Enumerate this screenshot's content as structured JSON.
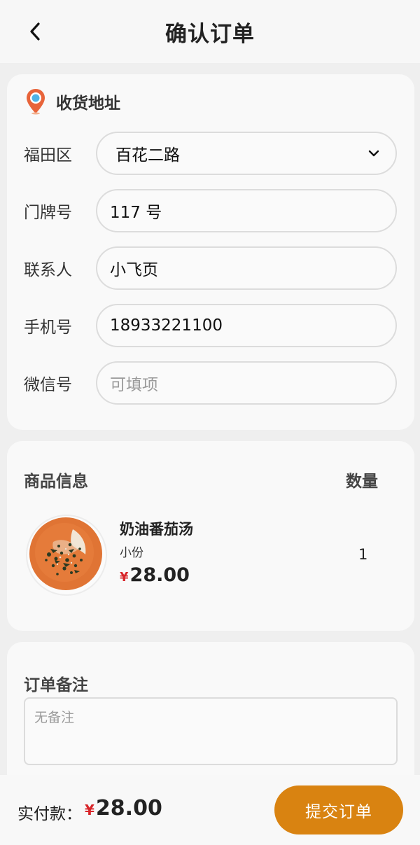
{
  "header": {
    "title": "确认订单"
  },
  "address": {
    "title": "收货地址",
    "rows": [
      {
        "label": "福田区",
        "value": "百花二路",
        "placeholder": ""
      },
      {
        "label": "门牌号",
        "value": "117 号",
        "placeholder": ""
      },
      {
        "label": "联系人",
        "value": "小飞页",
        "placeholder": ""
      },
      {
        "label": "手机号",
        "value": "18933221100",
        "placeholder": ""
      },
      {
        "label": "微信号",
        "value": "",
        "placeholder": "可填项"
      }
    ]
  },
  "goods": {
    "title": "商品信息",
    "qty_header": "数量",
    "items": [
      {
        "name": "奶油番茄汤",
        "size": "小份",
        "currency": "¥",
        "price": "28.00",
        "qty": "1"
      }
    ]
  },
  "note": {
    "title": "订单备注",
    "placeholder": "无备注"
  },
  "footer": {
    "pay_label": "实付款：",
    "currency": "¥",
    "total": "28.00",
    "submit_label": "提交订单"
  },
  "colors": {
    "accent": "#d98311",
    "price_red": "#d8262a",
    "pin_orange": "#e8643a",
    "pin_blue": "#4fb3e6"
  }
}
